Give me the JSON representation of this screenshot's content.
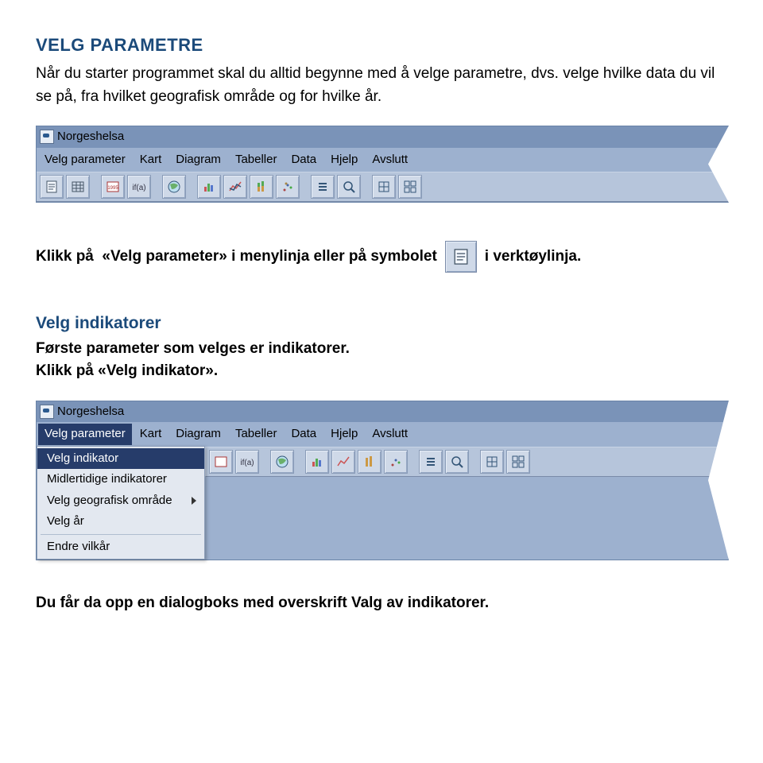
{
  "heading": "VELG PARAMETRE",
  "intro": "Når du starter programmet skal du alltid begynne med å velge parametre, dvs. velge hvilke data du vil se på, fra hvilket geografisk område og for hvilke år.",
  "app": {
    "title": "Norgeshelsa",
    "menu": [
      "Velg parameter",
      "Kart",
      "Diagram",
      "Tabeller",
      "Data",
      "Hjelp",
      "Avslutt"
    ]
  },
  "line2": {
    "pre": "Klikk på  «Velg parameter» i menylinja eller på symbolet",
    "post": "i verktøylinja."
  },
  "section2": {
    "title": "Velg indikatorer",
    "text": "Første parameter som velges er indikatorer.",
    "text2": "Klikk på «Velg indikator»."
  },
  "dropdown": {
    "items": [
      "Velg indikator",
      "Midlertidige indikatorer",
      "Velg geografisk område",
      "Velg år"
    ],
    "last": "Endre vilkår"
  },
  "footer": "Du  får da opp en dialogboks med overskrift Valg av indikatorer."
}
